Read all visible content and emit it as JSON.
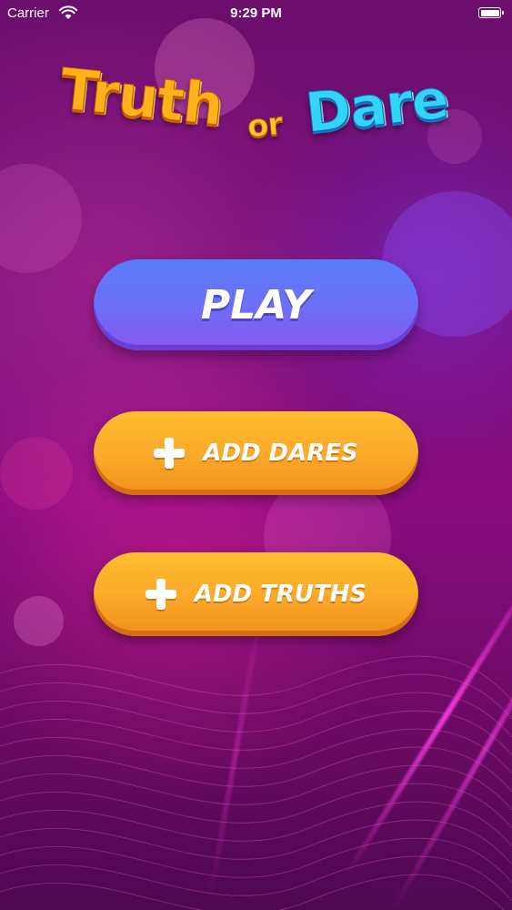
{
  "status_bar": {
    "carrier": "Carrier",
    "time": "9:29 PM",
    "wifi_icon": "wifi-icon",
    "battery_icon": "battery-icon"
  },
  "logo": {
    "word_truth": "Truth",
    "word_or": "or",
    "word_dare": "Dare",
    "colors": {
      "truth": "#ffb21a",
      "or": "#ffc52e",
      "dare": "#34d4f6"
    }
  },
  "buttons": {
    "play": {
      "label": "PLAY",
      "color": "#6d6ef7"
    },
    "add_dares": {
      "label": "ADD DARES",
      "icon": "plus-icon",
      "color": "#fba82a"
    },
    "add_truths": {
      "label": "ADD TRUTHS",
      "icon": "plus-icon",
      "color": "#fba82a"
    }
  },
  "theme": {
    "background": "#7a0f78",
    "accent": "#ff3ce6"
  }
}
